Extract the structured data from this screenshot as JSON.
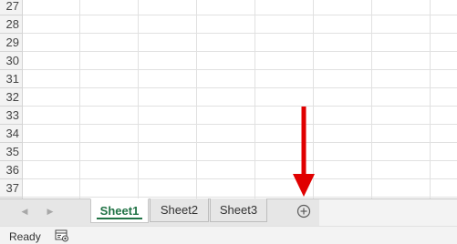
{
  "grid": {
    "row_numbers": [
      "27",
      "28",
      "29",
      "30",
      "31",
      "32",
      "33",
      "34",
      "35",
      "36",
      "37"
    ]
  },
  "sheet_tabs": {
    "tabs": [
      {
        "label": "Sheet1",
        "active": true
      },
      {
        "label": "Sheet2",
        "active": false
      },
      {
        "label": "Sheet3",
        "active": false
      }
    ],
    "add_icon": "plus-circle-icon",
    "nav_prev_icon": "triangle-left-icon",
    "nav_next_icon": "triangle-right-icon"
  },
  "status_bar": {
    "status": "Ready",
    "macro_icon": "macro-record-icon"
  },
  "annotation": {
    "arrow_color": "#e00000",
    "accent_color": "#217346"
  }
}
